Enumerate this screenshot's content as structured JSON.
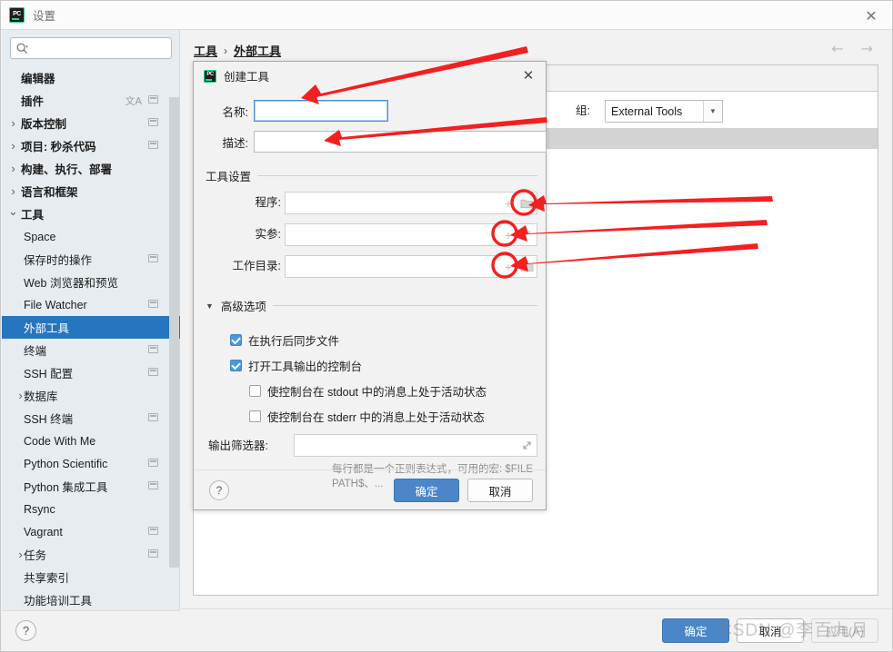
{
  "window": {
    "title": "设置",
    "logo_icon": "pycharm-logo-icon",
    "close_icon": "close-icon"
  },
  "sidebar": {
    "search": {
      "value": "",
      "placeholder": "",
      "icon": "search-icon"
    },
    "items": [
      {
        "label": "编辑器",
        "depth": 0,
        "bold": true,
        "arrow": "none",
        "badge": false
      },
      {
        "label": "插件",
        "depth": 0,
        "bold": true,
        "arrow": "none",
        "badge": true,
        "lang_badge": "文A"
      },
      {
        "label": "版本控制",
        "depth": 0,
        "bold": true,
        "arrow": "collapsed",
        "badge": true
      },
      {
        "label": "项目: 秒杀代码",
        "depth": 0,
        "bold": true,
        "arrow": "collapsed",
        "badge": true
      },
      {
        "label": "构建、执行、部署",
        "depth": 0,
        "bold": true,
        "arrow": "collapsed",
        "badge": false
      },
      {
        "label": "语言和框架",
        "depth": 0,
        "bold": true,
        "arrow": "collapsed",
        "badge": false
      },
      {
        "label": "工具",
        "depth": 0,
        "bold": true,
        "arrow": "expanded",
        "badge": false
      },
      {
        "label": "Space",
        "depth": 1,
        "bold": false,
        "arrow": "none",
        "badge": false
      },
      {
        "label": "保存时的操作",
        "depth": 1,
        "bold": false,
        "arrow": "none",
        "badge": true
      },
      {
        "label": "Web 浏览器和预览",
        "depth": 1,
        "bold": false,
        "arrow": "none",
        "badge": false
      },
      {
        "label": "File Watcher",
        "depth": 1,
        "bold": false,
        "arrow": "none",
        "badge": true
      },
      {
        "label": "外部工具",
        "depth": 1,
        "bold": false,
        "arrow": "none",
        "badge": false,
        "selected": true
      },
      {
        "label": "终端",
        "depth": 1,
        "bold": false,
        "arrow": "none",
        "badge": true
      },
      {
        "label": "SSH 配置",
        "depth": 1,
        "bold": false,
        "arrow": "none",
        "badge": true
      },
      {
        "label": "数据库",
        "depth": 1,
        "bold": false,
        "arrow": "collapsed",
        "badge": false
      },
      {
        "label": "SSH 终端",
        "depth": 1,
        "bold": false,
        "arrow": "none",
        "badge": true
      },
      {
        "label": "Code With Me",
        "depth": 1,
        "bold": false,
        "arrow": "none",
        "badge": false
      },
      {
        "label": "Python Scientific",
        "depth": 1,
        "bold": false,
        "arrow": "none",
        "badge": true
      },
      {
        "label": "Python 集成工具",
        "depth": 1,
        "bold": false,
        "arrow": "none",
        "badge": true
      },
      {
        "label": "Rsync",
        "depth": 1,
        "bold": false,
        "arrow": "none",
        "badge": false
      },
      {
        "label": "Vagrant",
        "depth": 1,
        "bold": false,
        "arrow": "none",
        "badge": true
      },
      {
        "label": "任务",
        "depth": 1,
        "bold": false,
        "arrow": "collapsed",
        "badge": true
      },
      {
        "label": "共享索引",
        "depth": 1,
        "bold": false,
        "arrow": "none",
        "badge": false
      },
      {
        "label": "功能培训工具",
        "depth": 1,
        "bold": false,
        "arrow": "none",
        "badge": false
      }
    ],
    "help_label": "?"
  },
  "breadcrumb": {
    "crumb1": "工具",
    "separator": "›",
    "crumb2": "外部工具"
  },
  "nav": {
    "back_icon": "arrow-left-icon",
    "forward_icon": "arrow-right-icon"
  },
  "dialog": {
    "title": "创建工具",
    "logo_icon": "pycharm-logo-icon",
    "close_icon": "close-icon",
    "name_label": "名称:",
    "name_value": "",
    "group_label": "组:",
    "group_value": "External Tools",
    "group_arrow_icon": "chevron-down-icon",
    "desc_label": "描述:",
    "desc_value": "",
    "tool_settings_title": "工具设置",
    "program_label": "程序:",
    "program_value": "",
    "program_plus_icon": "plus-icon",
    "program_browse_icon": "folder-icon",
    "args_label": "实参:",
    "args_value": "",
    "args_plus_icon": "plus-icon",
    "args_browse_icon": "expand-icon",
    "workdir_label": "工作目录:",
    "workdir_value": "",
    "workdir_plus_icon": "plus-icon",
    "workdir_browse_icon": "folder-icon",
    "advanced_title": "高级选项",
    "advanced_triangle_icon": "triangle-down-icon",
    "checkboxes": [
      {
        "label": "在执行后同步文件",
        "checked": true,
        "indent": 0
      },
      {
        "label": "打开工具输出的控制台",
        "checked": true,
        "indent": 0
      },
      {
        "label": "使控制台在 stdout 中的消息上处于活动状态",
        "checked": false,
        "indent": 1
      },
      {
        "label": "使控制台在 stderr 中的消息上处于活动状态",
        "checked": false,
        "indent": 1
      }
    ],
    "output_filter_label": "输出筛选器:",
    "output_filter_value": "",
    "output_filter_expand_icon": "expand-diagonal-icon",
    "hint": "每行都是一个正则表达式，可用的宏: $FILE PATH$、...",
    "help_label": "?",
    "ok_label": "确定",
    "cancel_label": "取消"
  },
  "footer": {
    "ok_label": "确定",
    "cancel_label": "取消",
    "apply_label": "应用(A)"
  },
  "watermark": "CSDN @李百九月",
  "annotations": {
    "color": "#f41f1f",
    "arrow_count": 5,
    "circle_count": 3,
    "targets": [
      "name-input",
      "desc-input",
      "program-browse-button",
      "args-plus-button",
      "workdir-plus-button"
    ]
  },
  "colors": {
    "accent_blue": "#2675bf",
    "button_blue": "#4a86c8",
    "sidebar_bg": "#e7ecf0",
    "panel_bg": "#f2f2f2",
    "annotation_red": "#f41f1f",
    "checkbox_blue": "#4a97e0"
  }
}
